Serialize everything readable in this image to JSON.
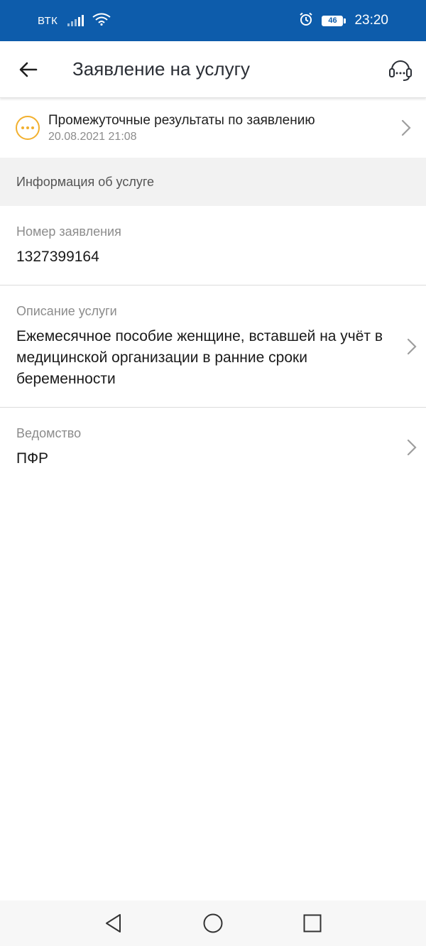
{
  "status_bar": {
    "carrier": "ВТК",
    "battery": "46",
    "time": "23:20"
  },
  "app_bar": {
    "title": "Заявление на услугу"
  },
  "result": {
    "title": "Промежуточные результаты по заявлению",
    "date": "20.08.2021 21:08",
    "accent_color": "#f2b02e"
  },
  "section": {
    "title": "Информация об услуге"
  },
  "fields": [
    {
      "label": "Номер заявления",
      "value": "1327399164"
    },
    {
      "label": "Описание услуги",
      "value": "Ежемесячное пособие женщине, вставшей на учёт в медицинской организации в ранние сроки беременности"
    },
    {
      "label": "Ведомство",
      "value": "ПФР"
    }
  ],
  "colors": {
    "status_bar_bg": "#0d5cab",
    "section_bg": "#f2f2f2"
  }
}
